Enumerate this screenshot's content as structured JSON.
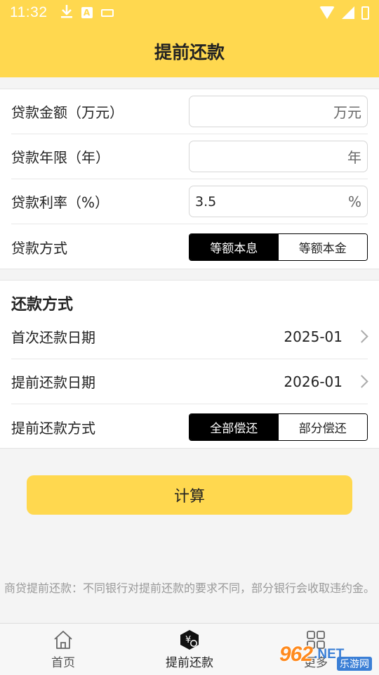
{
  "status_bar": {
    "time": "11:32",
    "icons": [
      "download-icon",
      "a-badge-icon",
      "keyboard-icon",
      "wifi-icon",
      "signal-icon",
      "battery-icon"
    ],
    "badge_letter": "A"
  },
  "header": {
    "title": "提前还款"
  },
  "loan_form": {
    "amount": {
      "label": "贷款金额（万元）",
      "value": "",
      "unit": "万元"
    },
    "years": {
      "label": "贷款年限（年）",
      "value": "",
      "unit": "年"
    },
    "rate": {
      "label": "贷款利率（%）",
      "value": "3.5",
      "unit": "%"
    },
    "method": {
      "label": "贷款方式",
      "options": [
        "等额本息",
        "等额本金"
      ],
      "selected_index": 0
    }
  },
  "repayment": {
    "section_title": "还款方式",
    "first_date": {
      "label": "首次还款日期",
      "value": "2025-01"
    },
    "prepay_date": {
      "label": "提前还款日期",
      "value": "2026-01"
    },
    "prepay_method": {
      "label": "提前还款方式",
      "options": [
        "全部偿还",
        "部分偿还"
      ],
      "selected_index": 0
    }
  },
  "calculate_label": "计算",
  "note": "商贷提前还款：不同银行对提前还款的要求不同，部分银行会收取违约金。",
  "tabs": [
    {
      "label": "首页",
      "icon": "home-icon",
      "active": false
    },
    {
      "label": "提前还款",
      "icon": "yuan-repay-icon",
      "active": true
    },
    {
      "label": "更多",
      "icon": "more-grid-icon",
      "active": false
    }
  ],
  "watermark": {
    "logo": "962",
    "suffix": ".NET",
    "sub": "乐游网"
  },
  "colors": {
    "accent": "#ffd84f",
    "selected_segment": "#000000",
    "note_text": "#999999"
  }
}
